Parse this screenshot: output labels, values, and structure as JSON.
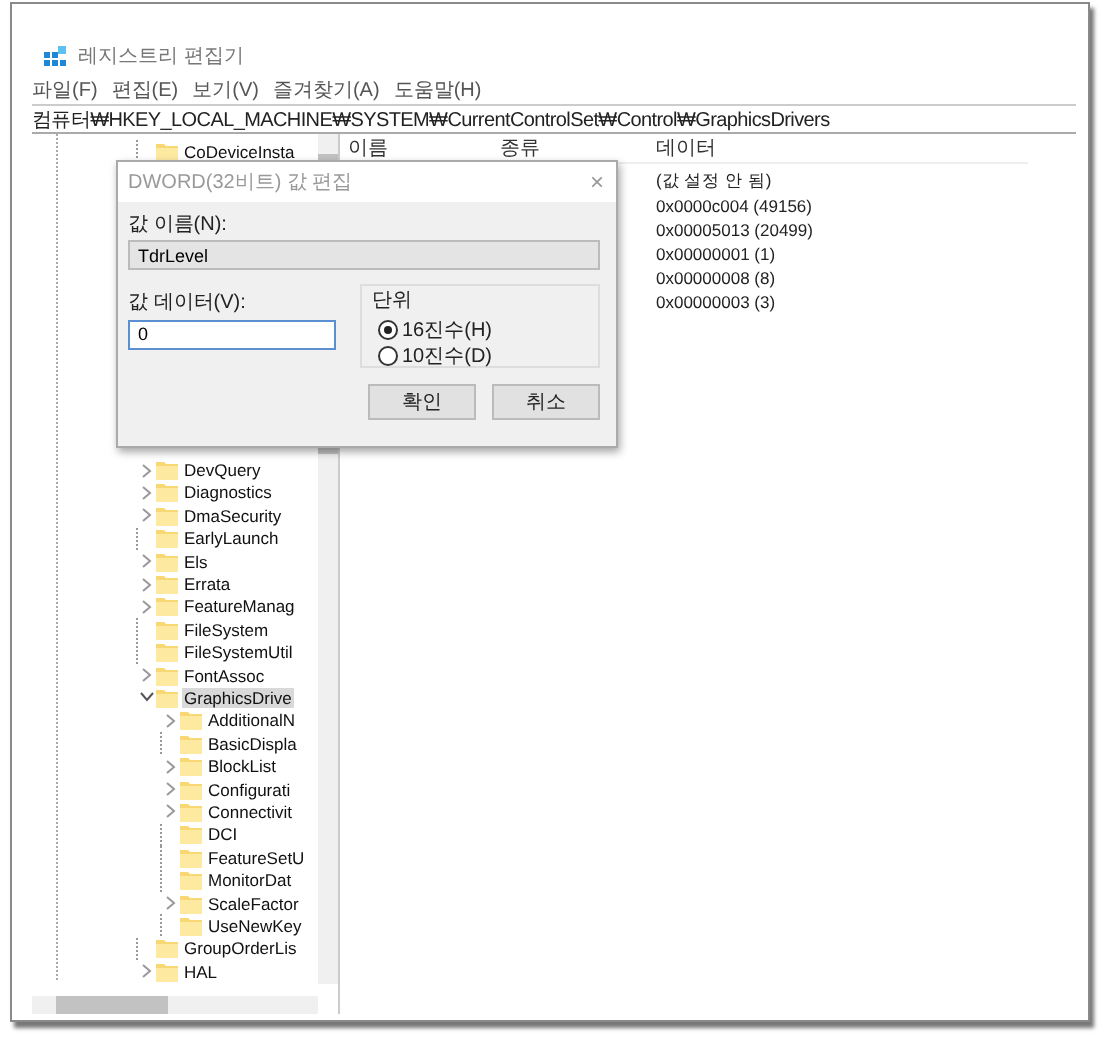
{
  "window": {
    "title": "레지스트리 편집기"
  },
  "menu": [
    "파일(F)",
    "편집(E)",
    "보기(V)",
    "즐겨찾기(A)",
    "도움말(H)"
  ],
  "address": "컴퓨터₩HKEY_LOCAL_MACHINE₩SYSTEM₩CurrentControlSet₩Control₩GraphicsDrivers",
  "tree": {
    "top_items": [
      {
        "label": "CoDeviceInsta",
        "kind": "leaf",
        "selected": false
      }
    ],
    "items": [
      {
        "label": "DevQuery",
        "kind": "branch",
        "expanded": false,
        "selected": false
      },
      {
        "label": "Diagnostics",
        "kind": "branch",
        "expanded": false,
        "selected": false
      },
      {
        "label": "DmaSecurity",
        "kind": "branch",
        "expanded": false,
        "selected": false
      },
      {
        "label": "EarlyLaunch",
        "kind": "leaf",
        "selected": false
      },
      {
        "label": "Els",
        "kind": "branch",
        "expanded": false,
        "selected": false
      },
      {
        "label": "Errata",
        "kind": "branch",
        "expanded": false,
        "selected": false
      },
      {
        "label": "FeatureManag",
        "kind": "branch",
        "expanded": false,
        "selected": false
      },
      {
        "label": "FileSystem",
        "kind": "leaf",
        "selected": false
      },
      {
        "label": "FileSystemUtil",
        "kind": "leaf",
        "selected": false
      },
      {
        "label": "FontAssoc",
        "kind": "branch",
        "expanded": false,
        "selected": false
      },
      {
        "label": "GraphicsDrive",
        "kind": "branch",
        "expanded": true,
        "selected": true,
        "children": [
          {
            "label": "AdditionalN",
            "kind": "branch",
            "expanded": false,
            "selected": false
          },
          {
            "label": "BasicDispla",
            "kind": "leaf",
            "selected": false
          },
          {
            "label": "BlockList",
            "kind": "branch",
            "expanded": false,
            "selected": false
          },
          {
            "label": "Configurati",
            "kind": "branch",
            "expanded": false,
            "selected": false
          },
          {
            "label": "Connectivit",
            "kind": "branch",
            "expanded": false,
            "selected": false
          },
          {
            "label": "DCI",
            "kind": "leaf",
            "selected": false
          },
          {
            "label": "FeatureSetU",
            "kind": "leaf",
            "selected": false
          },
          {
            "label": "MonitorDat",
            "kind": "leaf",
            "selected": false
          },
          {
            "label": "ScaleFactor",
            "kind": "branch",
            "expanded": false,
            "selected": false
          },
          {
            "label": "UseNewKey",
            "kind": "leaf",
            "selected": false
          }
        ]
      },
      {
        "label": "GroupOrderLis",
        "kind": "leaf",
        "selected": false
      },
      {
        "label": "HAL",
        "kind": "branch",
        "expanded": false,
        "selected": false
      }
    ]
  },
  "table": {
    "columns": [
      "이름",
      "종류",
      "데이터"
    ],
    "rows": [
      {
        "data": "(값 설정 안 됨)"
      },
      {
        "data": "0x0000c004 (49156)"
      },
      {
        "data": "0x00005013 (20499)"
      },
      {
        "data": "0x00000001 (1)"
      },
      {
        "data": "0x00000008 (8)"
      },
      {
        "data": "0x00000003 (3)"
      }
    ]
  },
  "dialog": {
    "title": "DWORD(32비트) 값 편집",
    "close": "×",
    "name_label": "값 이름(N):",
    "name_value": "TdrLevel",
    "data_label": "값 데이터(V):",
    "data_value": "0",
    "units_label": "단위",
    "units": [
      {
        "label": "16진수(H)",
        "selected": true
      },
      {
        "label": "10진수(D)",
        "selected": false
      }
    ],
    "buttons": [
      "확인",
      "취소"
    ]
  }
}
